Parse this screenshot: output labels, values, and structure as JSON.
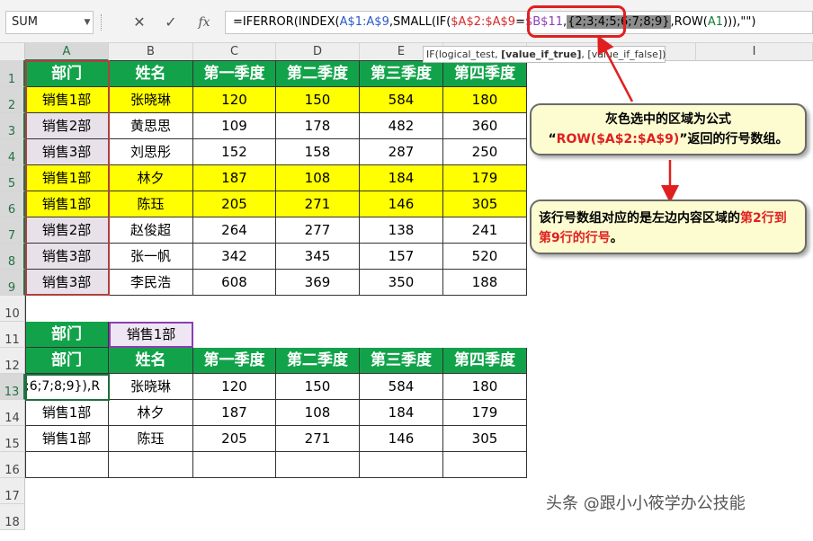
{
  "formula_bar": {
    "name_box": "SUM",
    "cancel_icon": "✕",
    "enter_icon": "✓",
    "fx_icon": "fx",
    "formula_parts": {
      "p1": "=IFERROR(INDEX(",
      "p2": "A$1:A$9",
      "p3": ",SMALL(IF(",
      "p4": "$A$2:$A$9",
      "p5": "=",
      "p6": "$B$11",
      "p7": ",",
      "p8": "{2;3;4;5;6;7;8;9}",
      "p9": ",ROW(",
      "p10": "A1",
      "p11": "))),\"\")"
    },
    "tooltip": {
      "t1": "IF(logical_test, ",
      "t2": "[value_if_true]",
      "t3": ", [value_if_false])"
    }
  },
  "columns": [
    "A",
    "B",
    "C",
    "D",
    "E",
    "F",
    "G",
    "H",
    "I"
  ],
  "rows": [
    "1",
    "2",
    "3",
    "4",
    "5",
    "6",
    "7",
    "8",
    "9",
    "10",
    "11",
    "12",
    "13",
    "14",
    "15",
    "16",
    "17",
    "18"
  ],
  "table1": {
    "headers": [
      "部门",
      "姓名",
      "第一季度",
      "第二季度",
      "第三季度",
      "第四季度"
    ],
    "rows": [
      [
        "销售1部",
        "张晓琳",
        "120",
        "150",
        "584",
        "180"
      ],
      [
        "销售2部",
        "黄思思",
        "109",
        "178",
        "482",
        "360"
      ],
      [
        "销售3部",
        "刘思彤",
        "152",
        "158",
        "287",
        "250"
      ],
      [
        "销售1部",
        "林夕",
        "187",
        "108",
        "184",
        "179"
      ],
      [
        "销售1部",
        "陈珏",
        "205",
        "271",
        "146",
        "305"
      ],
      [
        "销售2部",
        "赵俊超",
        "264",
        "277",
        "138",
        "241"
      ],
      [
        "销售3部",
        "张一帆",
        "342",
        "345",
        "157",
        "520"
      ],
      [
        "销售3部",
        "李民浩",
        "608",
        "369",
        "350",
        "188"
      ]
    ]
  },
  "criteria": {
    "label": "部门",
    "value": "销售1部"
  },
  "table2": {
    "headers": [
      "部门",
      "姓名",
      "第一季度",
      "第二季度",
      "第三季度",
      "第四季度"
    ],
    "rows": [
      [
        ";6;7;8;9}),R",
        "张晓琳",
        "120",
        "150",
        "584",
        "180"
      ],
      [
        "销售1部",
        "林夕",
        "187",
        "108",
        "184",
        "179"
      ],
      [
        "销售1部",
        "陈珏",
        "205",
        "271",
        "146",
        "305"
      ],
      [
        "",
        "",
        "",
        "",
        "",
        ""
      ]
    ]
  },
  "callouts": {
    "c1_line1": "灰色选中的区域为公式",
    "c1_q1": "“",
    "c1_red": "ROW($A$2:$A$9)",
    "c1_rest": "”返回的行号数组。",
    "c2_part1": "该行号数组对应的是左边内容区域的",
    "c2_red1": "第",
    "c2_red2": "2行到第9行的行号",
    "c2_end": "。"
  },
  "watermark": "头条 @跟小小筱学办公技能",
  "colors": {
    "header_green": "#12a34a",
    "highlight_yellow": "#ffff00",
    "arrow_red": "#e02020"
  }
}
